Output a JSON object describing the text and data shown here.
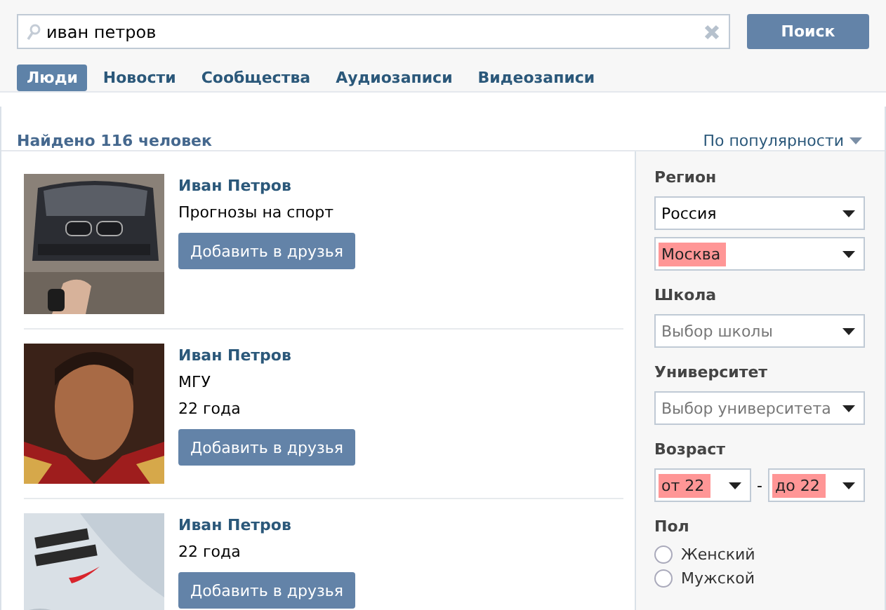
{
  "search": {
    "value": "иван петров",
    "button": "Поиск"
  },
  "tabs": [
    {
      "label": "Люди",
      "selected": true
    },
    {
      "label": "Новости",
      "selected": false
    },
    {
      "label": "Сообщества",
      "selected": false
    },
    {
      "label": "Аудиозаписи",
      "selected": false
    },
    {
      "label": "Видеозаписи",
      "selected": false
    }
  ],
  "results_header": {
    "count": "Найдено 116 человек",
    "sort": "По популярности"
  },
  "people": [
    {
      "name": "Иван Петров",
      "details": [
        "Прогнозы на спорт"
      ],
      "button": "Добавить в друзья"
    },
    {
      "name": "Иван Петров",
      "details": [
        "МГУ",
        "22 года"
      ],
      "button": "Добавить в друзья"
    },
    {
      "name": "Иван Петров",
      "details": [
        "22 года"
      ],
      "button": "Добавить в друзья"
    }
  ],
  "filters": [
    {
      "label": "Регион",
      "kind": "selects",
      "selects": [
        {
          "value": "Россия",
          "placeholder": false,
          "highlighted": false
        },
        {
          "value": "Москва",
          "placeholder": false,
          "highlighted": true
        }
      ]
    },
    {
      "label": "Школа",
      "kind": "selects",
      "selects": [
        {
          "value": "Выбор школы",
          "placeholder": true,
          "highlighted": false
        }
      ]
    },
    {
      "label": "Университет",
      "kind": "selects",
      "selects": [
        {
          "value": "Выбор университета",
          "placeholder": true,
          "highlighted": false
        }
      ]
    },
    {
      "label": "Возраст",
      "kind": "range",
      "from": {
        "value": "от 22",
        "highlighted": true
      },
      "separator": "-",
      "to": {
        "value": "до 22",
        "highlighted": true
      }
    },
    {
      "label": "Пол",
      "kind": "radios",
      "options": [
        {
          "label": "Женский",
          "selected": false
        },
        {
          "label": "Мужской",
          "selected": false
        }
      ]
    }
  ]
}
